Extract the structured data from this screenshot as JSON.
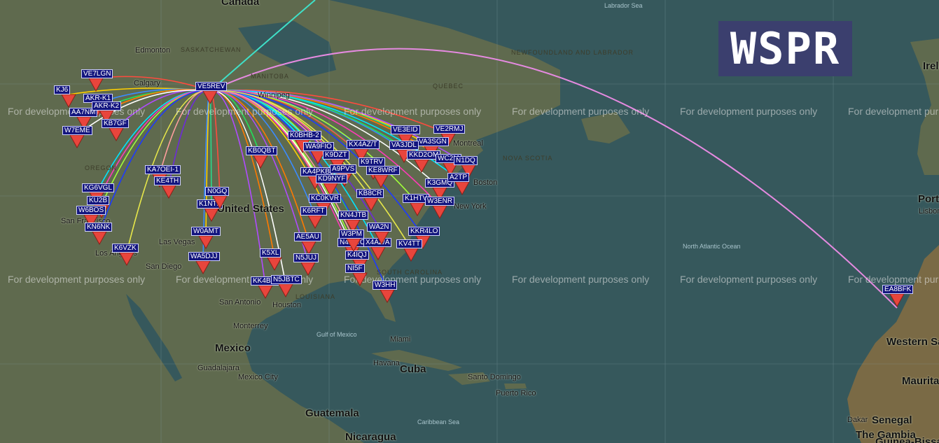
{
  "app": {
    "logo_text": "WSPR"
  },
  "colors": {
    "ocean": "#36585c",
    "land": "#5f6a4e",
    "pin": "#e8453c",
    "label_bg": "#13157e",
    "long_path": "#e58ae0",
    "north_path": "#3fe0c8"
  },
  "watermark_text": "For development purposes only",
  "transmitter": {
    "call": "VE5REV"
  },
  "places": [
    {
      "name": "Canada",
      "type": "country"
    },
    {
      "name": "Labrador Sea",
      "type": "sea"
    },
    {
      "name": "Edmonton",
      "type": "city"
    },
    {
      "name": "SASKATCHEWAN",
      "type": "region"
    },
    {
      "name": "MANITOBA",
      "type": "region"
    },
    {
      "name": "NEWFOUNDLAND AND LABRADOR",
      "type": "region"
    },
    {
      "name": "Calgary",
      "type": "city"
    },
    {
      "name": "Winnipeg",
      "type": "city"
    },
    {
      "name": "QUEBEC",
      "type": "region"
    },
    {
      "name": "Montreal",
      "type": "city"
    },
    {
      "name": "NOVA SCOTIA",
      "type": "region"
    },
    {
      "name": "Boston",
      "type": "city"
    },
    {
      "name": "New York",
      "type": "city"
    },
    {
      "name": "United States",
      "type": "country"
    },
    {
      "name": "Las Vegas",
      "type": "city"
    },
    {
      "name": "San Diego",
      "type": "city"
    },
    {
      "name": "Los Angeles",
      "type": "city"
    },
    {
      "name": "San Francisco",
      "type": "city"
    },
    {
      "name": "OREGON",
      "type": "region"
    },
    {
      "name": "SOUTH CAROLINA",
      "type": "region"
    },
    {
      "name": "LOUISIANA",
      "type": "region"
    },
    {
      "name": "San Antonio",
      "type": "city"
    },
    {
      "name": "Houston",
      "type": "city"
    },
    {
      "name": "Monterrey",
      "type": "city"
    },
    {
      "name": "Mexico",
      "type": "country"
    },
    {
      "name": "Guadalajara",
      "type": "city"
    },
    {
      "name": "Mexico City",
      "type": "city"
    },
    {
      "name": "Gulf of Mexico",
      "type": "sea"
    },
    {
      "name": "Miami",
      "type": "city"
    },
    {
      "name": "Havana",
      "type": "city"
    },
    {
      "name": "Cuba",
      "type": "country"
    },
    {
      "name": "Santo Domingo",
      "type": "city"
    },
    {
      "name": "Puerto Rico",
      "type": "city"
    },
    {
      "name": "Guatemala",
      "type": "country"
    },
    {
      "name": "Caribbean Sea",
      "type": "sea"
    },
    {
      "name": "Nicaragua",
      "type": "country"
    },
    {
      "name": "North Atlantic Ocean",
      "type": "sea"
    },
    {
      "name": "Portugal",
      "type": "country"
    },
    {
      "name": "Lisbon",
      "type": "city"
    },
    {
      "name": "Western Sahara",
      "type": "country"
    },
    {
      "name": "Mauritania",
      "type": "country"
    },
    {
      "name": "Dakar",
      "type": "city"
    },
    {
      "name": "Senegal",
      "type": "country"
    },
    {
      "name": "The Gambia",
      "type": "country"
    },
    {
      "name": "Guinea-Bissau",
      "type": "country"
    },
    {
      "name": "Irela",
      "type": "country"
    }
  ],
  "receivers": [
    "VE7LGN",
    "KJ6",
    "AKR-K1",
    "AA7NM",
    "AKR-K2",
    "KB7GF",
    "W7EME",
    "KG6VGL",
    "KU2B",
    "W6BOS",
    "KN6NK",
    "K6VZK",
    "KA7OEI-1",
    "KE4TH",
    "K1NTL",
    "N0GQ",
    "W0AMT",
    "WA5DJJ",
    "KB0QBT",
    "K5XL",
    "KK4BCN",
    "N5JBTC",
    "K0BHB-2",
    "WA9FIO",
    "K9DZT",
    "KX4AZ/T",
    "KA4PKB",
    "A9PVS",
    "KD9NYF",
    "K9TRV",
    "KE8WRF",
    "KC0KVR",
    "K6RFT",
    "KN4JTB",
    "AE5AU",
    "N5JUJ",
    "N4XWC",
    "X4AZ/A",
    "K4IQJ",
    "NI5F",
    "W3HH",
    "KB8CR",
    "W3PM",
    "WA2N",
    "VE3EID",
    "VE2RMJ",
    "VA3SGN",
    "VA3JDL",
    "KKD2OM",
    "WC2M",
    "N1DQ",
    "K3GMQ",
    "A2TP",
    "K1HTV",
    "W3ENR",
    "KKR4LO",
    "KV4TT",
    "EA8BFK"
  ]
}
